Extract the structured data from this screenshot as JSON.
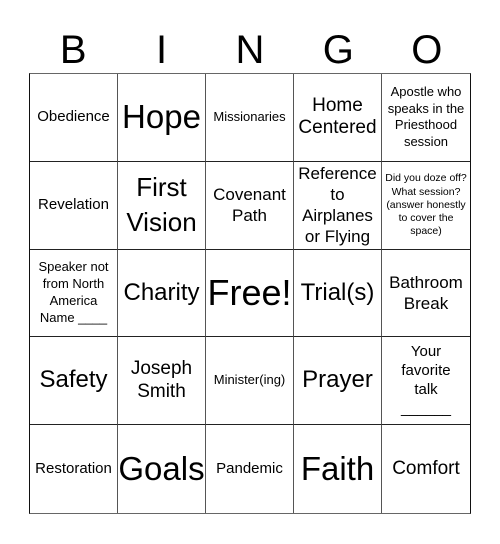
{
  "header": {
    "letters": [
      "B",
      "I",
      "N",
      "G",
      "O"
    ]
  },
  "cells": [
    {
      "text": "Obedience"
    },
    {
      "text": "Hope"
    },
    {
      "text": "Missionaries"
    },
    {
      "text": "Home\nCentered"
    },
    {
      "text": "Apostle who\nspeaks in the\nPriesthood\nsession"
    },
    {
      "text": "Revelation"
    },
    {
      "text": "First\nVision"
    },
    {
      "text": "Covenant\nPath"
    },
    {
      "text": "Reference\nto\nAirplanes\nor Flying"
    },
    {
      "text": "Did you doze off?\nWhat session?\n(answer honestly\nto cover the\nspace)"
    },
    {
      "text": "Speaker not\nfrom North\nAmerica\nName ____"
    },
    {
      "text": "Charity"
    },
    {
      "text": "Free!"
    },
    {
      "text": "Trial(s)"
    },
    {
      "text": "Bathroom\nBreak"
    },
    {
      "text": "Safety"
    },
    {
      "text": "Joseph\nSmith"
    },
    {
      "text": "Minister(ing)"
    },
    {
      "text": "Prayer"
    },
    {
      "text": "Your\nfavorite\ntalk\n______"
    },
    {
      "text": "Restoration"
    },
    {
      "text": "Goals"
    },
    {
      "text": "Pandemic"
    },
    {
      "text": "Faith"
    },
    {
      "text": "Comfort"
    }
  ]
}
